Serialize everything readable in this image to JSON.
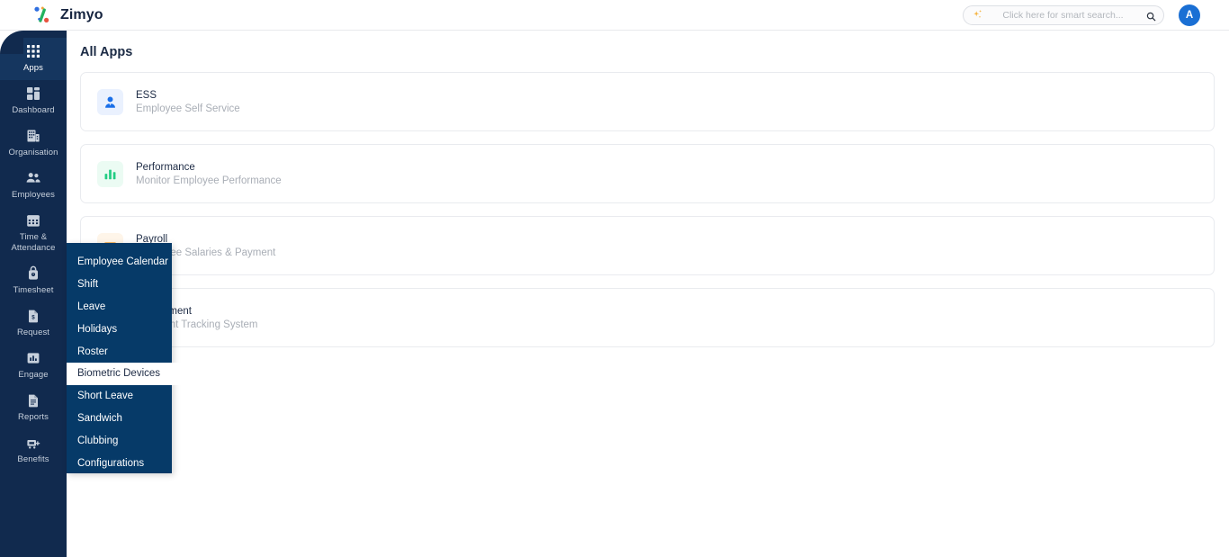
{
  "app": {
    "brand_name": "Zimyo",
    "logo_icon": "zimyo-percent-logo"
  },
  "topbar": {
    "search": {
      "placeholder": "Click here for smart search...",
      "value": "",
      "sparkle_icon": "sparkle-icon",
      "search_icon": "search-icon"
    },
    "avatar_initial": "A"
  },
  "sidebar": {
    "items": [
      {
        "label": "Apps",
        "icon": "grid-apps-icon",
        "active": true
      },
      {
        "label": "Dashboard",
        "icon": "dashboard-icon",
        "active": false
      },
      {
        "label": "Organisation",
        "icon": "building-icon",
        "active": false
      },
      {
        "label": "Employees",
        "icon": "people-icon",
        "active": false
      },
      {
        "label": "Time & Attendance",
        "icon": "calendar-icon",
        "active": false
      },
      {
        "label": "Timesheet",
        "icon": "timesheet-icon",
        "active": false
      },
      {
        "label": "Request",
        "icon": "request-doc-icon",
        "active": false
      },
      {
        "label": "Engage",
        "icon": "engage-chart-icon",
        "active": false
      },
      {
        "label": "Reports",
        "icon": "reports-doc-icon",
        "active": false
      },
      {
        "label": "Benefits",
        "icon": "benefits-cart-icon",
        "active": false
      }
    ]
  },
  "main": {
    "page_title": "All Apps",
    "cards": [
      {
        "name": "ESS",
        "description": "Employee Self Service",
        "icon": "person-icon",
        "icon_color": "#1a6fe8",
        "icon_bg": "#eaf1fe"
      },
      {
        "name": "Performance",
        "description": "Monitor Employee Performance",
        "icon": "bar-chart-icon",
        "icon_color": "#22cd83",
        "icon_bg": "#ebfbf3"
      },
      {
        "name": "Payroll",
        "description": "Employee Salaries & Payment",
        "icon": "payroll-icon",
        "icon_color": "#f2a33c",
        "icon_bg": "#fef5e9"
      },
      {
        "name": "Recruitment",
        "description": "Applicant Tracking System",
        "icon": "recruitment-icon",
        "icon_color": "#8b5cf6",
        "icon_bg": "#f3eefe"
      }
    ]
  },
  "flyout_menu": {
    "items": [
      {
        "label": "Employee Calendar",
        "highlight": false
      },
      {
        "label": "Shift",
        "highlight": false
      },
      {
        "label": "Leave",
        "highlight": false
      },
      {
        "label": "Holidays",
        "highlight": false
      },
      {
        "label": "Roster",
        "highlight": false
      },
      {
        "label": "Biometric Devices",
        "highlight": true
      },
      {
        "label": "Short Leave",
        "highlight": false
      },
      {
        "label": "Sandwich",
        "highlight": false
      },
      {
        "label": "Clubbing",
        "highlight": false
      },
      {
        "label": "Configurations",
        "highlight": false
      }
    ]
  },
  "colors": {
    "sidebar_bg": "#112a4e",
    "sidebar_active": "#15365f",
    "flyout_bg": "#063a68",
    "accent_blue": "#1a6fd4",
    "text_dark": "#1d2b45",
    "text_muted": "#a9aeb6"
  }
}
